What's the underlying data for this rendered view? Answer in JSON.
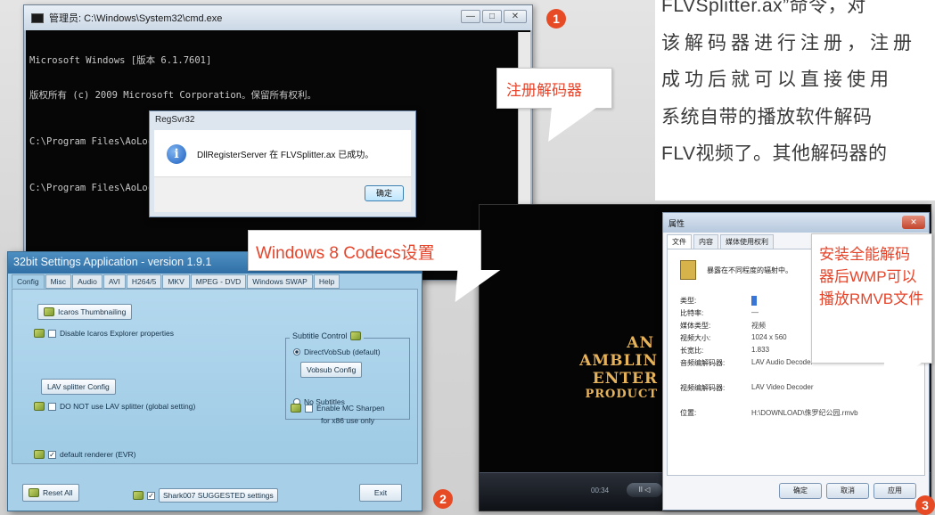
{
  "article": {
    "lines": [
      "FLVSplitter.ax”命令，对",
      "该解码器进行注册，注册",
      "成功后就可以直接使用",
      "系统自带的播放软件解码",
      "FLV视频了。其他解码器的"
    ]
  },
  "cmd_window": {
    "title": "管理员: C:\\Windows\\System32\\cmd.exe",
    "controls": {
      "minimize": "—",
      "maximize": "□",
      "close": "✕"
    },
    "lines": [
      "Microsoft Windows [版本 6.1.7601]",
      "版权所有 (c) 2009 Microsoft Corporation。保留所有权利。",
      "C:\\Program Files\\AoLocal>regsvr32.exe FLVSplitter.ax",
      "C:\\Program Files\\AoLocal>"
    ],
    "dialog": {
      "title": "RegSvr32",
      "icon": "info-icon",
      "icon_glyph": "i",
      "message": "DllRegisterServer 在 FLVSplitter.ax 已成功。",
      "ok_label": "确定"
    }
  },
  "settings_window": {
    "title": "32bit Settings Application - version 1.9.1",
    "tabs": [
      "Config",
      "Misc",
      "Audio",
      "AVI",
      "H264/5",
      "MKV",
      "MPEG - DVD",
      "Windows SWAP",
      "Help"
    ],
    "active_tab": "Config",
    "icaros_button": "Icaros Thumbnailing",
    "disable_icaros": {
      "label": "Disable Icaros Explorer properties",
      "checked": false
    },
    "lav_button": "LAV splitter Config",
    "no_lav": {
      "label": "DO NOT use LAV splitter (global setting)",
      "checked": false
    },
    "default_renderer": {
      "label": "default renderer (EVR)",
      "checked": true
    },
    "subtitle": {
      "title": "Subtitle Control",
      "directvobsub": {
        "label": "DirectVobSub (default)",
        "selected": true
      },
      "vobsub_button": "Vobsub Config",
      "no_subtitles": {
        "label": "No Subtitles",
        "selected": false
      }
    },
    "enable_mc": {
      "label_line1": "Enable MC Sharpen",
      "label_line2": "for x86 use only",
      "checked": false
    },
    "reset_button": "Reset All",
    "suggested": {
      "label": "Shark007 SUGGESTED settings",
      "checked": true
    },
    "exit_button": "Exit"
  },
  "player_window": {
    "film_text": {
      "line1_an": "AN",
      "line2": "AMBLIN ENTER",
      "line3": "PRODUCT"
    },
    "time": "00:34",
    "controls_label": "II  ◁",
    "properties": {
      "title": "属性",
      "close": "✕",
      "tabs": [
        "文件",
        "内容",
        "媒体使用权利"
      ],
      "filename": "暴露在不同程度的辐射中。",
      "rows": [
        {
          "key": "类型:",
          "value": "",
          "selected": true
        },
        {
          "key": "比特率:",
          "value": "—",
          "selected": false
        },
        {
          "key": "媒体类型:",
          "value": "视频",
          "selected": false
        },
        {
          "key": "视频大小:",
          "value": "1024 x 560",
          "selected": false
        },
        {
          "key": "长宽比:",
          "value": "1.833",
          "selected": false
        },
        {
          "key": "音频编解码器:",
          "value": "LAV Audio Decoder",
          "selected": false
        },
        {
          "key": "视频编解码器:",
          "value": "LAV Video Decoder",
          "selected": false
        },
        {
          "key": "位置:",
          "value": "H:\\DOWNLOAD\\侏罗纪公园.rmvb",
          "selected": false
        }
      ],
      "buttons": [
        "确定",
        "取消",
        "应用"
      ]
    }
  },
  "callouts": {
    "c1": "注册解码器",
    "c2": "Windows 8 Codecs设置",
    "c3": "安装全能解码器后WMP可以播放RMVB文件"
  },
  "badges": {
    "b1": "1",
    "b2": "2",
    "b3": "3"
  },
  "colors": {
    "accent_red": "#e6452b",
    "badge_red": "#e64b26"
  }
}
